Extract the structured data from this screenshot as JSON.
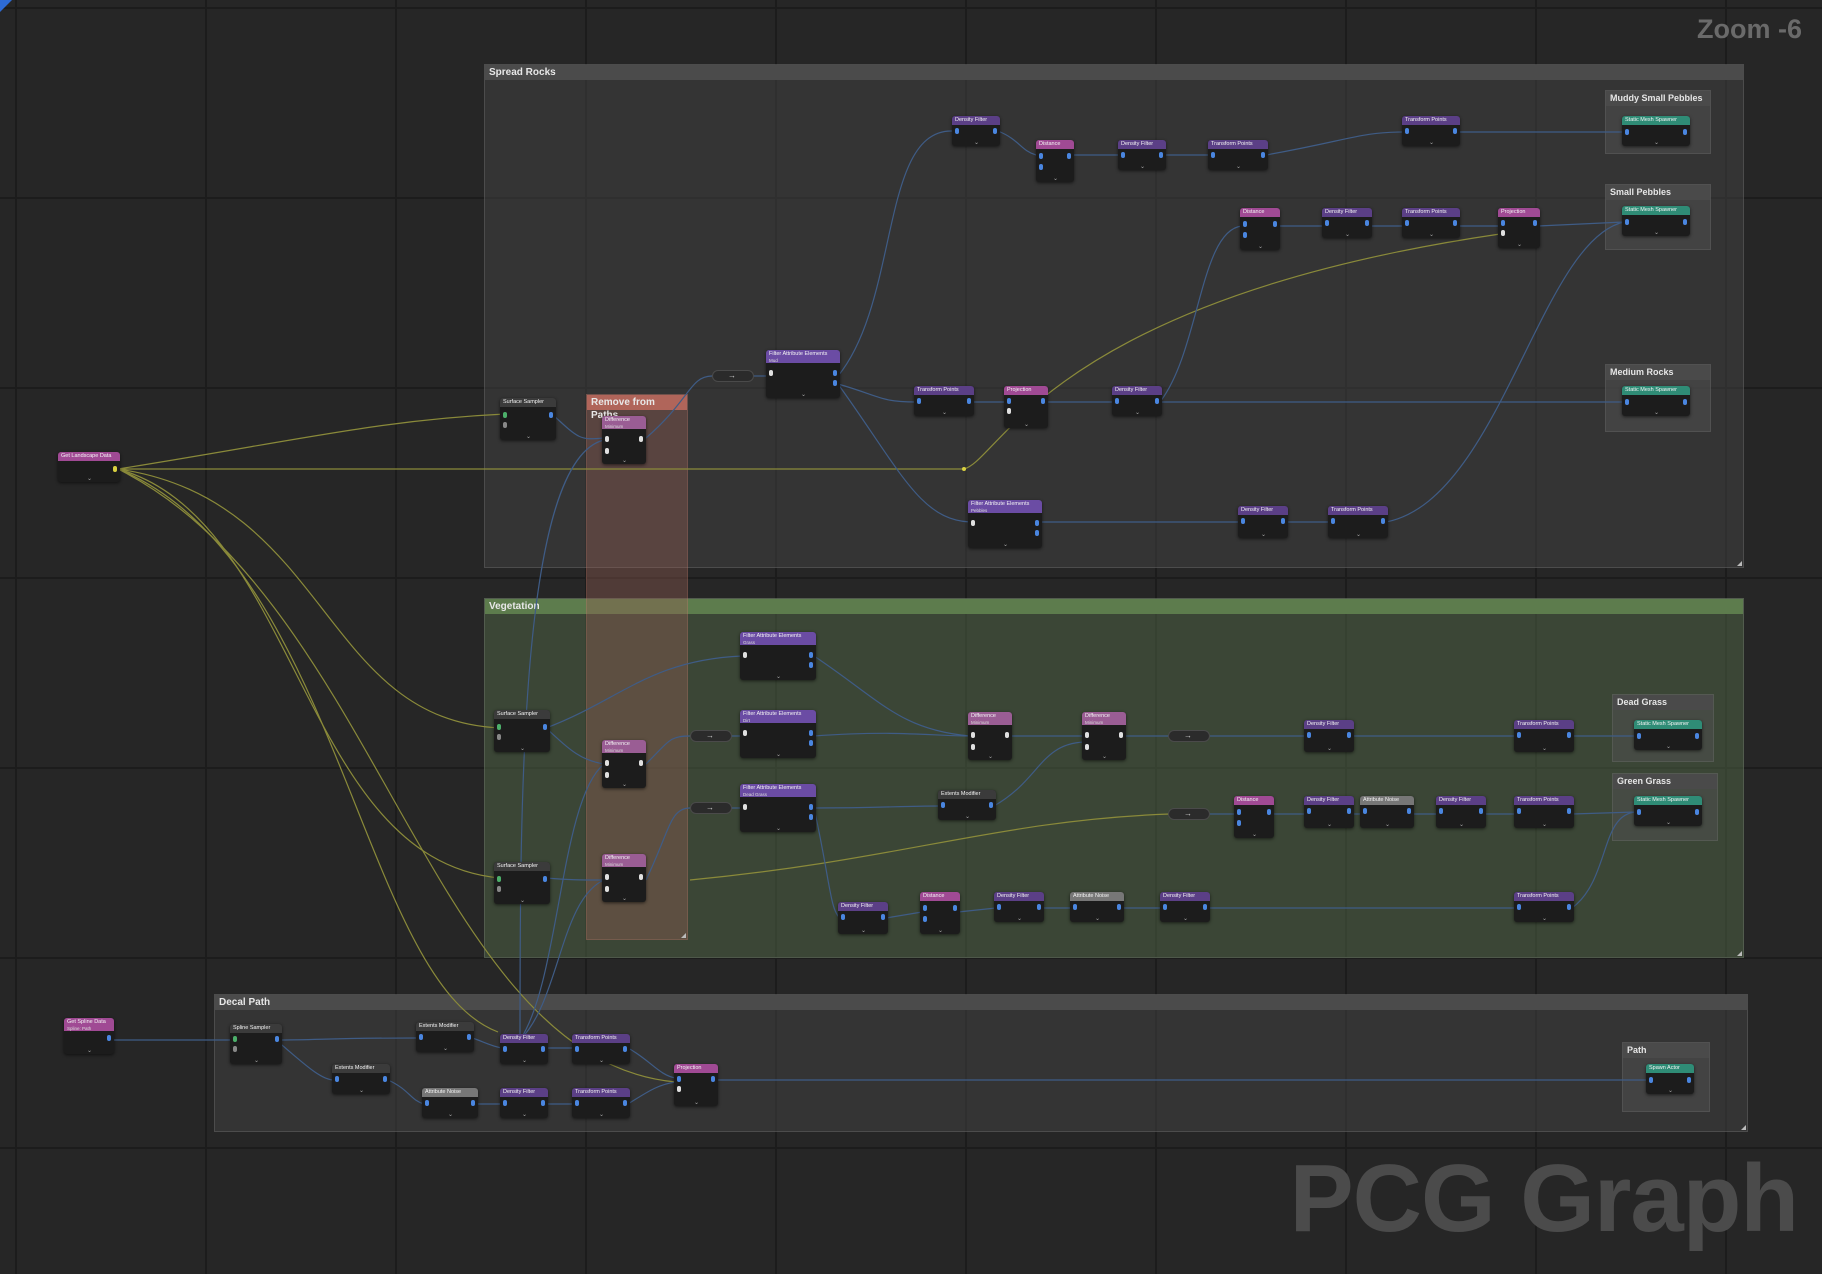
{
  "hud": {
    "zoom": "Zoom -6",
    "watermark": "PCG Graph"
  },
  "colors": {
    "pin_blue": "#4a86e0",
    "pin_green": "#4caf6a",
    "pin_white": "#e0e0e0",
    "pin_yellow": "#d8d040",
    "wire_blue": "#3f5c86",
    "wire_yellow": "#8a8a3a"
  },
  "comments": {
    "spread_rocks": "Spread Rocks",
    "remove_from_paths": "Remove from Paths",
    "vegetation": "Vegetation",
    "decal_path": "Decal Path"
  },
  "outputs": {
    "muddy_small_pebbles": "Muddy Small Pebbles",
    "small_pebbles": "Small Pebbles",
    "medium_rocks": "Medium Rocks",
    "dead_grass": "Dead Grass",
    "green_grass": "Green Grass",
    "path": "Path"
  },
  "node_titles": {
    "get_landscape_data": "Get Landscape Data",
    "get_spline_data": "Get Spline Data",
    "surface_sampler": "Surface Sampler",
    "spline_sampler": "Spline Sampler",
    "difference": "Difference",
    "density_filter": "Density Filter",
    "distance": "Distance",
    "transform_points": "Transform Points",
    "projection": "Projection",
    "filter_attribute_elements": "Filter Attribute Elements",
    "static_mesh_spawner": "Static Mesh Spawner",
    "spawn_actor": "Spawn Actor",
    "extents_modifier": "Extents Modifier",
    "attribute_noise": "Attribute Noise"
  },
  "node_subtitles": {
    "minimum": "Minimum",
    "spline_path": "Spline: Path",
    "mud": "Mud",
    "pebbles": "Pebbles",
    "grass": "Grass",
    "dirt": "Dirt",
    "dead_grass": "Dead Grass"
  }
}
